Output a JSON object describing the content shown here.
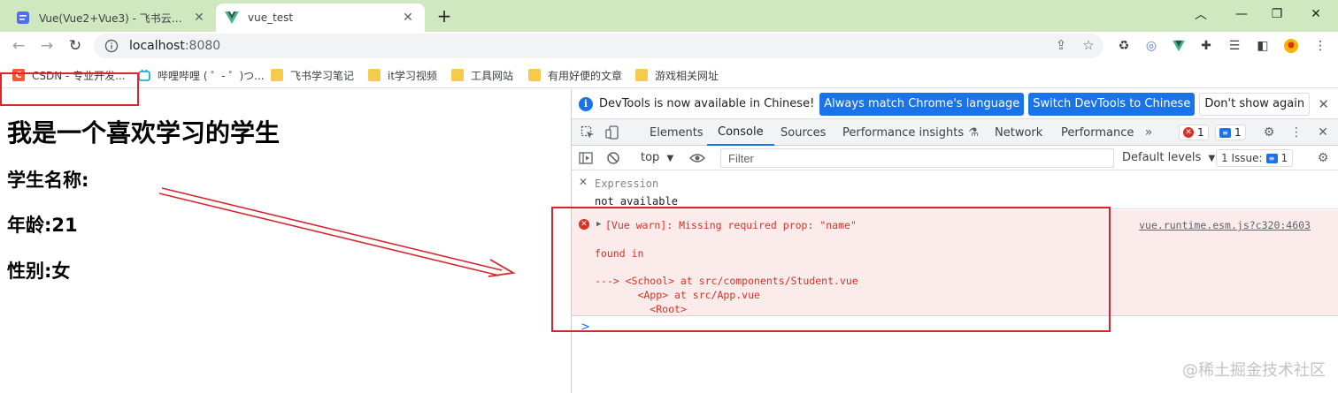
{
  "tabs": [
    {
      "title": "Vue(Vue2+Vue3) - 飞书云文档",
      "favicon": "doc-icon"
    },
    {
      "title": "vue_test",
      "favicon": "vue-logo"
    }
  ],
  "window_controls": {
    "minimize": "︿",
    "restore": "—",
    "maximize": "❐",
    "close": "✕"
  },
  "address": {
    "host": "localhost",
    "port": ":8080"
  },
  "bookmarks": [
    {
      "label": "CSDN - 专业开发...",
      "icon_text": "C",
      "color": "#fc5531"
    },
    {
      "label": "哔哩哔哩 ( ゜- ゜)つ...",
      "icon_text": "",
      "color": "#00a1d6"
    },
    {
      "label": "飞书学习笔记",
      "folder": true
    },
    {
      "label": "it学习视频",
      "folder": true
    },
    {
      "label": "工具网站",
      "folder": true
    },
    {
      "label": "有用好便的文章",
      "folder": true
    },
    {
      "label": "游戏相关网址",
      "folder": true
    }
  ],
  "page": {
    "heading": "我是一个喜欢学习的学生",
    "name_label": "学生名称:",
    "age_label": "年龄:21",
    "gender_label": "性别:女"
  },
  "devtools": {
    "info_message": "DevTools is now available in Chinese!",
    "btn_match": "Always match Chrome's language",
    "btn_switch": "Switch DevTools to Chinese",
    "btn_dismiss": "Don't show again",
    "tabs": [
      "Elements",
      "Console",
      "Sources",
      "Performance insights",
      "Network",
      "Performance"
    ],
    "more": "»",
    "error_count": "1",
    "message_count": "1",
    "context": "top",
    "filter_placeholder": "Filter",
    "levels": "Default levels",
    "issues": "1 Issue:",
    "issues_count": "1",
    "live_expression_label": "Expression",
    "live_expression_value": "not available",
    "warn_line1": "[Vue warn]: Missing required prop: \"name\"",
    "warn_line2": "found in",
    "warn_line3": "---> <School> at src/components/Student.vue",
    "warn_line4": "       <App> at src/App.vue",
    "warn_line5": "         <Root>",
    "warn_source": "vue.runtime.esm.js?c320:4603",
    "prompt": ">"
  },
  "watermark": "@稀土掘金技术社区",
  "colors": {
    "annotation_red": "#d6262d",
    "accent_blue": "#1a73e8",
    "tabstrip": "#cfe8c0"
  }
}
